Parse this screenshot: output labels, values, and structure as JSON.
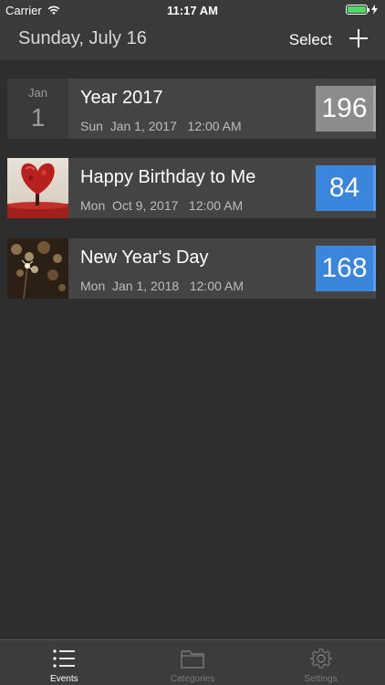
{
  "status_bar": {
    "carrier": "Carrier",
    "time": "11:17 AM",
    "battery_level": 1.0,
    "battery_color": "#4cd964"
  },
  "nav": {
    "title": "Sunday, July 16",
    "select_label": "Select",
    "add_icon": "plus-icon"
  },
  "events": [
    {
      "title": "Year 2017",
      "date": "Sun  Jan 1, 2017   12:00 AM",
      "days": "196",
      "thumb_type": "date-tile",
      "thumb_month": "Jan",
      "thumb_day": "1",
      "count_color": "#8c8c8c"
    },
    {
      "title": "Happy Birthday to Me",
      "date": "Mon  Oct 9, 2017   12:00 AM",
      "days": "84",
      "thumb_type": "image",
      "thumb_icon": "heart-tree-image",
      "count_color": "#3b86dd"
    },
    {
      "title": "New Year's Day",
      "date": "Mon  Jan 1, 2018   12:00 AM",
      "days": "168",
      "thumb_type": "image",
      "thumb_icon": "sparkler-image",
      "count_color": "#3b86dd"
    }
  ],
  "tabs": [
    {
      "label": "Events",
      "icon": "list-icon",
      "active": true
    },
    {
      "label": "Categories",
      "icon": "folder-icon",
      "active": false
    },
    {
      "label": "Settings",
      "icon": "gear-icon",
      "active": false
    }
  ]
}
